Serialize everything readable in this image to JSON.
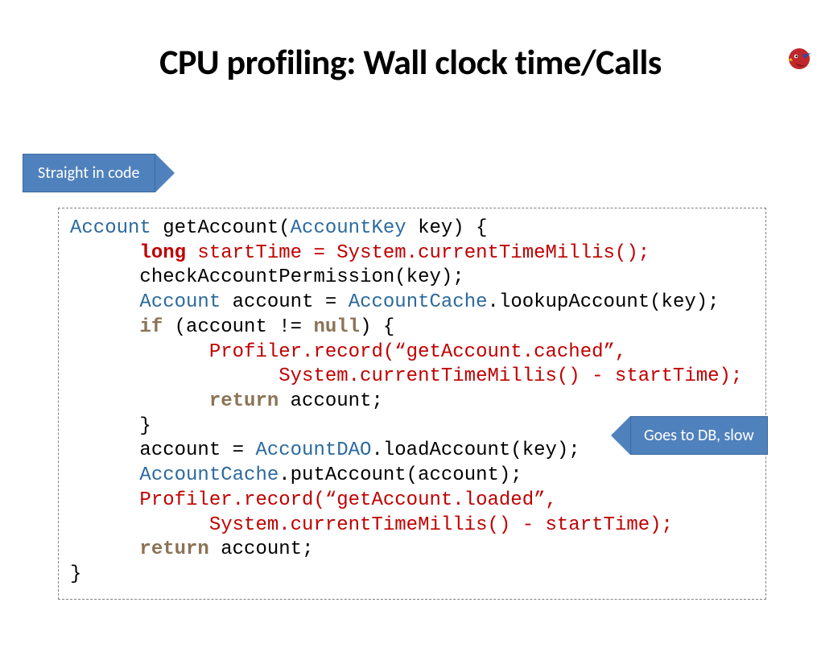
{
  "title": "CPU profiling: Wall clock time/Calls",
  "callouts": {
    "left": "Straight in code",
    "right": "Goes to DB, slow"
  },
  "code": {
    "l1a": "Account",
    "l1b": " getAccount(",
    "l1c": "AccountKey",
    "l1d": " key) {",
    "l2a": "      ",
    "l2b": "long",
    "l2c": " startTime = System.currentTimeMillis();",
    "l3": "      checkAccountPermission(key);",
    "l4a": "      ",
    "l4b": "Account",
    "l4c": " account = ",
    "l4d": "AccountCache",
    "l4e": ".lookupAccount(key);",
    "l5a": "      ",
    "l5b": "if",
    "l5c": " (account != ",
    "l5d": "null",
    "l5e": ") {",
    "l6": "            Profiler.record(“getAccount.cached”,",
    "l7": "                  System.currentTimeMillis() - startTime);",
    "l8a": "            ",
    "l8b": "return",
    "l8c": " account;",
    "l9": "      }",
    "l10a": "      account = ",
    "l10b": "AccountDAO",
    "l10c": ".loadAccount(key);",
    "l11a": "      ",
    "l11b": "AccountCache",
    "l11c": ".putAccount(account);",
    "l12": "      Profiler.record(“getAccount.loaded”,",
    "l13": "            System.currentTimeMillis() - startTime);",
    "l14a": "      ",
    "l14b": "return",
    "l14c": " account;",
    "l15": "}"
  }
}
